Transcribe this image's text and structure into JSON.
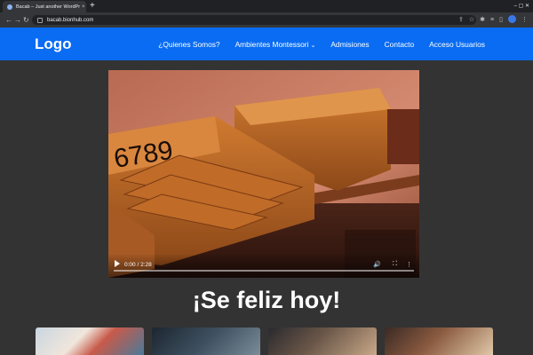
{
  "browser": {
    "tab_title": "Bacab – Just another WordPress site",
    "tab_close": "×",
    "new_tab": "+",
    "window_controls": "–  ▢  ✕",
    "back": "←",
    "forward": "→",
    "reload": "↻",
    "url": "bacab.bionhub.com",
    "toolbar_icons": [
      "share-icon",
      "star-icon",
      "extensions-icon",
      "reading-list-icon",
      "sidepanel-icon",
      "profile-icon",
      "menu-icon"
    ]
  },
  "site": {
    "logo": "Logo",
    "brand_color": "#0a6cf3",
    "nav": [
      {
        "label": "¿Quienes Somos?"
      },
      {
        "label": "Ambientes Montessori",
        "dropdown": true
      },
      {
        "label": "Admisiones"
      },
      {
        "label": "Contacto"
      },
      {
        "label": "Acceso Usuarios"
      }
    ],
    "video": {
      "numbers_on_box": "6789",
      "time": "0:00 / 2:28",
      "progress": 0
    },
    "headline": "¡Se feliz hoy!"
  }
}
